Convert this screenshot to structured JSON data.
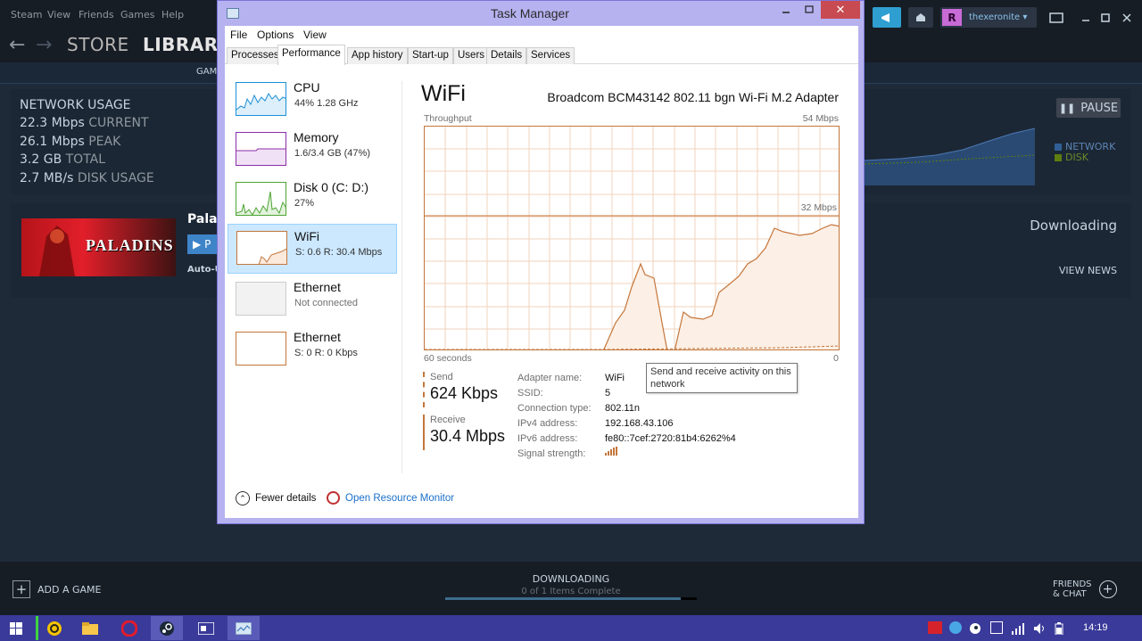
{
  "steam": {
    "menu": [
      "Steam",
      "View",
      "Friends",
      "Games",
      "Help"
    ],
    "nav": {
      "store": "STORE",
      "library": "LIBRARY",
      "sub_partial": "GAM"
    },
    "user": {
      "name": "thexeronite ▾",
      "avatar_letter": "R"
    },
    "network": {
      "title": "NETWORK USAGE",
      "current_value": "22.3 Mbps",
      "current_label": "CURRENT",
      "peak_value": "26.1 Mbps",
      "peak_label": "PEAK",
      "total_value": "3.2 GB",
      "total_label": "TOTAL",
      "disk_value": "2.7 MB/s",
      "disk_label": "DISK USAGE",
      "pause": "PAUSE",
      "legend_network": "NETWORK",
      "legend_disk": "DISK"
    },
    "download": {
      "game_title": "Palad",
      "game_logo": "PALADINS",
      "play_partial": "P",
      "auto_update": "Auto-Up",
      "status": "Downloading",
      "view_news": "VIEW NEWS"
    },
    "bottom": {
      "add_game": "ADD A GAME",
      "downloading": "DOWNLOADING",
      "items": "0 of 1 Items Complete",
      "friends_line1": "FRIENDS",
      "friends_line2": "& CHAT"
    }
  },
  "task_manager": {
    "title": "Task Manager",
    "menu": [
      "File",
      "Options",
      "View"
    ],
    "tabs": [
      "Processes",
      "Performance",
      "App history",
      "Start-up",
      "Users",
      "Details",
      "Services"
    ],
    "active_tab": "Performance",
    "sidebar": [
      {
        "name": "CPU",
        "sub": "44%  1.28 GHz"
      },
      {
        "name": "Memory",
        "sub": "1.6/3.4 GB (47%)"
      },
      {
        "name": "Disk 0 (C: D:)",
        "sub": "27%"
      },
      {
        "name": "WiFi",
        "sub": "S: 0.6  R: 30.4 Mbps"
      },
      {
        "name": "Ethernet",
        "sub": "Not connected"
      },
      {
        "name": "Ethernet",
        "sub": "S: 0  R: 0 Kbps"
      }
    ],
    "selected": "WiFi",
    "detail": {
      "title": "WiFi",
      "adapter": "Broadcom BCM43142 802.11 bgn Wi-Fi M.2 Adapter",
      "throughput_label": "Throughput",
      "max_label": "54 Mbps",
      "mid_label": "32 Mbps",
      "time_label": "60 seconds",
      "zero_label": "0",
      "tooltip": "Send and receive activity on this network",
      "send_label": "Send",
      "send_value": "624 Kbps",
      "receive_label": "Receive",
      "receive_value": "30.4 Mbps",
      "props": [
        {
          "label": "Adapter name:",
          "value": "WiFi"
        },
        {
          "label": "SSID:",
          "value": "5"
        },
        {
          "label": "Connection type:",
          "value": "802.11n"
        },
        {
          "label": "IPv4 address:",
          "value": "192.168.43.106"
        },
        {
          "label": "IPv6 address:",
          "value": "fe80::7cef:2720:81b4:6262%4"
        },
        {
          "label": "Signal strength:",
          "value": ""
        }
      ]
    },
    "footer": {
      "fewer": "Fewer details",
      "monitor": "Open Resource Monitor"
    }
  },
  "taskbar": {
    "clock": "14:19"
  },
  "colors": {
    "steam_bg": "#1b2838",
    "tm_accent": "#c4763b",
    "network_legend": "#2f5f96",
    "disk_legend": "#5c7e10"
  }
}
